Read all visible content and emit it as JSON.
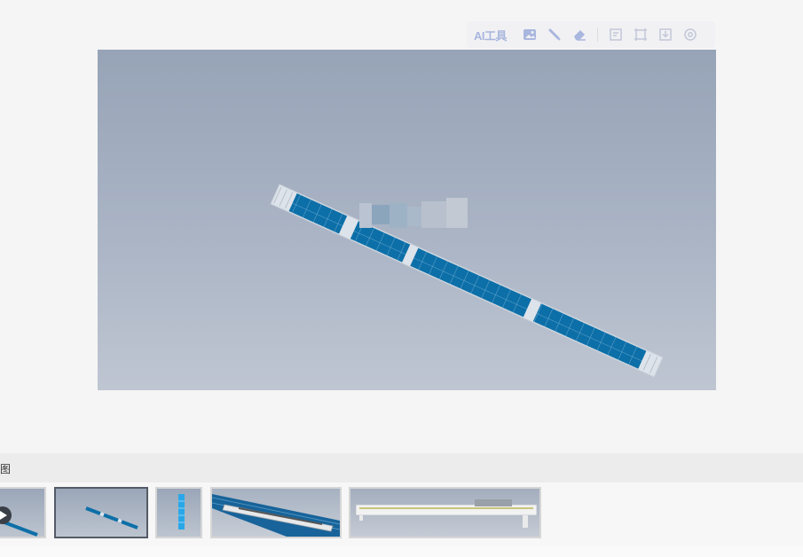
{
  "toolbar": {
    "ai_label": "AI工具",
    "icons": [
      "image-icon",
      "brush-icon",
      "eraser-icon",
      "crop-icon",
      "expand-icon",
      "download-icon",
      "settings-icon"
    ],
    "icon_color": "#a9b6de"
  },
  "viewer": {
    "description_color_panels": "#0d6fa8",
    "background_top": "#97a4b7",
    "background_bottom": "#bfc6d2"
  },
  "strip": {
    "label": "图"
  },
  "thumbnails": [
    {
      "name": "thumb-video",
      "has_play": true
    },
    {
      "name": "thumb-top-view",
      "active": true
    },
    {
      "name": "thumb-end-view"
    },
    {
      "name": "thumb-perspective"
    },
    {
      "name": "thumb-side-view"
    }
  ]
}
